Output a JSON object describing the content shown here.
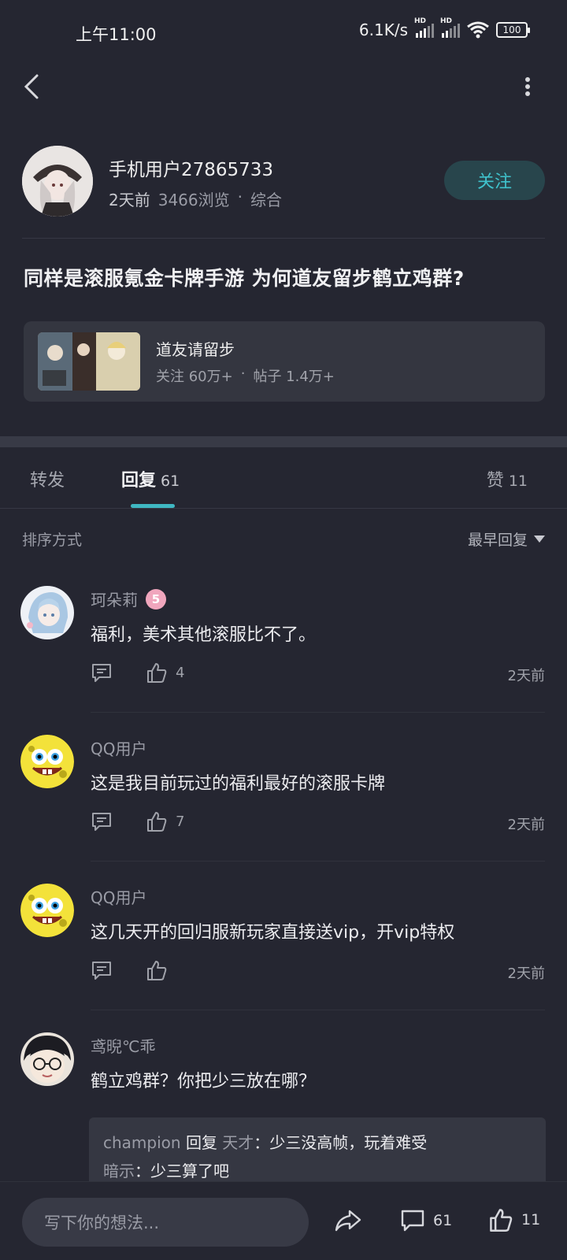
{
  "status_bar": {
    "time": "上午11:00",
    "net_speed": "6.1K/s",
    "battery": "100",
    "hd_label": "HD"
  },
  "author": {
    "name": "手机用户27865733",
    "time_ago": "2天前",
    "views": "3466浏览",
    "dot": "·",
    "category": "综合",
    "follow_label": "关注"
  },
  "post": {
    "title": "同样是滚服氪金卡牌手游 为何道友留步鹤立鸡群?"
  },
  "game_card": {
    "name": "道友请留步",
    "followers": "关注 60万+",
    "dot": "·",
    "posts": "帖子 1.4万+"
  },
  "tabs": [
    {
      "label": "转发",
      "count": ""
    },
    {
      "label": "回复",
      "count": "61"
    },
    {
      "label": "赞",
      "count": "11"
    }
  ],
  "sort": {
    "label": "排序方式",
    "selected": "最早回复"
  },
  "comments": [
    {
      "user": "珂朵莉",
      "badge": "5",
      "text": "福利，美术其他滚服比不了。",
      "likes": "4",
      "time": "2天前"
    },
    {
      "user": "QQ用户",
      "text": "这是我目前玩过的福利最好的滚服卡牌",
      "likes": "7",
      "time": "2天前"
    },
    {
      "user": "QQ用户",
      "text": "这几天开的回归服新玩家直接送vip，开vip特权",
      "likes": "",
      "time": "2天前"
    },
    {
      "user": "鸢晲℃乖",
      "text": "鹤立鸡群？你把少三放在哪？",
      "replies": [
        {
          "user": "champion",
          "verb": "回复",
          "target": "天才",
          "sep": "：",
          "text": "少三没高帧，玩着难受"
        },
        {
          "user": "暗示",
          "sep": "：",
          "text": "少三算了吧"
        }
      ]
    }
  ],
  "bottom_bar": {
    "input_placeholder": "写下你的想法...",
    "comment_count": "61",
    "like_count": "11"
  },
  "icons": [
    "back-icon",
    "more-icon",
    "comment-icon",
    "like-icon",
    "share-icon",
    "dropdown-icon",
    "wifi-icon",
    "signal-icon",
    "battery-icon"
  ],
  "colors": {
    "background": "#252631",
    "accent": "#3fb7c2",
    "follow_bg": "#28454c",
    "card_bg": "#343640"
  }
}
